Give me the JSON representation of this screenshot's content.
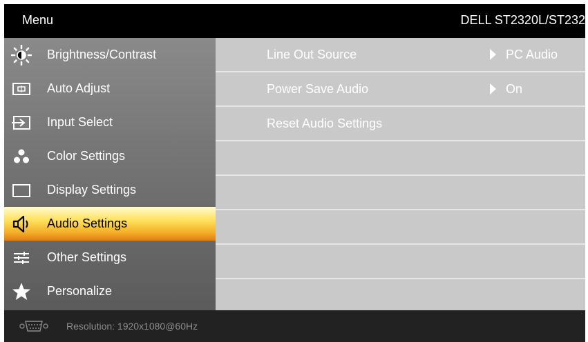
{
  "header": {
    "menu_title": "Menu",
    "model": "DELL  ST2320L/ST232"
  },
  "sidebar": {
    "items": [
      {
        "label": "Brightness/Contrast",
        "icon": "brightness-icon"
      },
      {
        "label": "Auto Adjust",
        "icon": "auto-adjust-icon"
      },
      {
        "label": "Input Select",
        "icon": "input-select-icon"
      },
      {
        "label": "Color Settings",
        "icon": "color-settings-icon"
      },
      {
        "label": "Display Settings",
        "icon": "display-settings-icon"
      },
      {
        "label": "Audio Settings",
        "icon": "speaker-icon",
        "active": true
      },
      {
        "label": "Other Settings",
        "icon": "sliders-icon"
      },
      {
        "label": "Personalize",
        "icon": "star-icon"
      }
    ]
  },
  "audio": {
    "rows": [
      {
        "label": "Line Out Source",
        "value": "PC Audio"
      },
      {
        "label": "Power Save Audio",
        "value": "On"
      },
      {
        "label": "Reset Audio Settings",
        "value": ""
      }
    ]
  },
  "footer": {
    "resolution": "Resolution:  1920x1080@60Hz",
    "icon": "vga-connector-icon"
  },
  "colors": {
    "active_top": "#fffbd0",
    "active_bottom": "#e07e14",
    "panel": "#c9c9c9",
    "sidebar": "#747474"
  }
}
